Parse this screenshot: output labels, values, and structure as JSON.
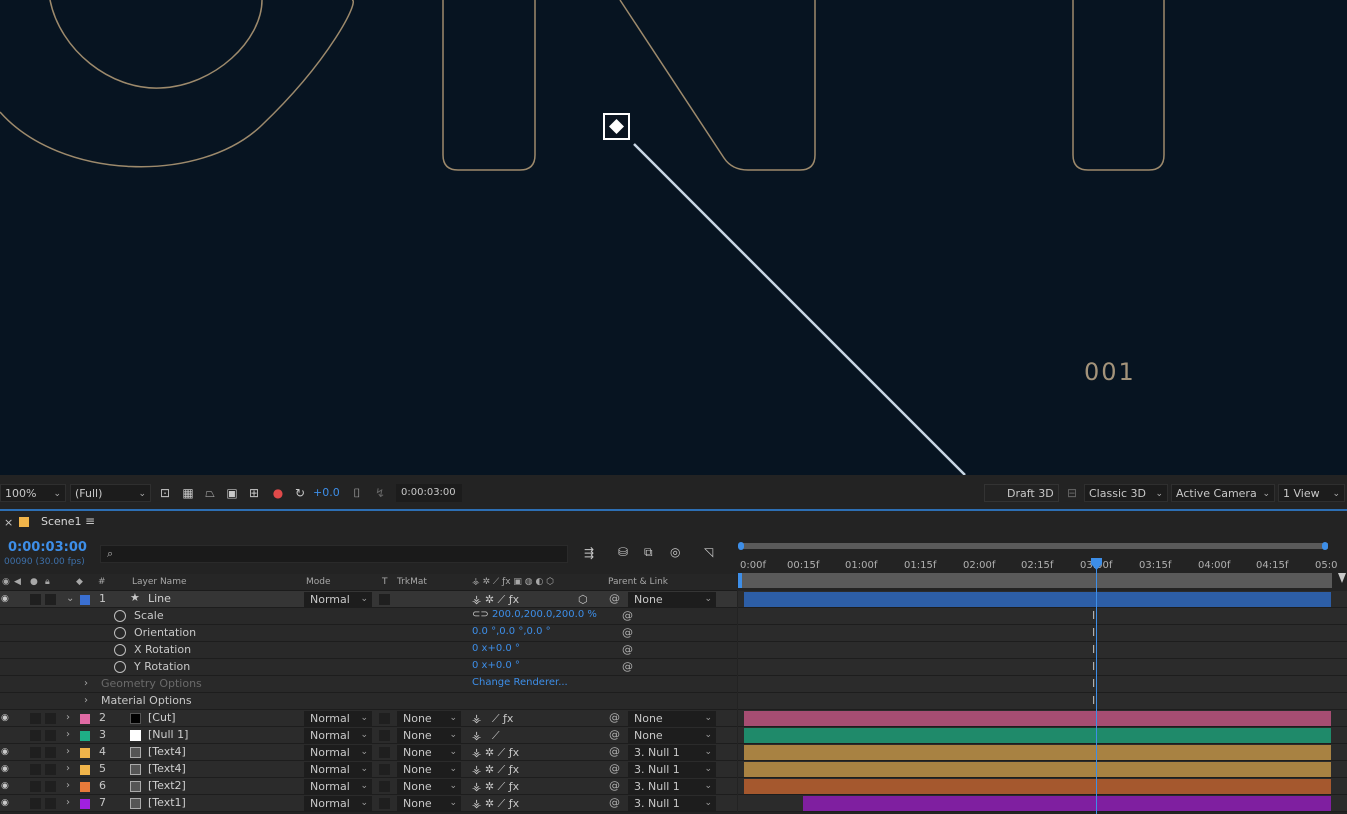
{
  "viewer": {
    "frame_number": "001",
    "zoom": "100%",
    "resolution": "(Full)",
    "exposure": "+0.0",
    "current_time": "0:00:03:00",
    "renderer": "Draft 3D",
    "renderer_mode": "Classic 3D",
    "camera": "Active Camera",
    "views": "1 View"
  },
  "panel": {
    "close": "×",
    "title": "Scene1",
    "menu": "≡"
  },
  "timeline": {
    "timecode": "0:00:03:00",
    "frames": "00090 (30.00 fps)",
    "search_placeholder": "",
    "ruler": [
      "0:00f",
      "00:15f",
      "01:00f",
      "01:15f",
      "02:00f",
      "02:15f",
      "03:00f",
      "03:15f",
      "04:00f",
      "04:15f",
      "05:0"
    ]
  },
  "columns": {
    "hash": "#",
    "layer_name": "Layer Name",
    "mode": "Mode",
    "t": "T",
    "trkmat": "TrkMat",
    "parent": "Parent & Link"
  },
  "layers": [
    {
      "num": "1",
      "name": "Line",
      "mode": "Normal",
      "trkmat": "",
      "parent": "None",
      "color": "#3a6fd1"
    },
    {
      "num": "2",
      "name": "[Cut]",
      "mode": "Normal",
      "trkmat": "None",
      "parent": "None",
      "color": "#e06aa4"
    },
    {
      "num": "3",
      "name": "[Null 1]",
      "mode": "Normal",
      "trkmat": "None",
      "parent": "None",
      "color": "#1fae86"
    },
    {
      "num": "4",
      "name": "[Text4]",
      "mode": "Normal",
      "trkmat": "None",
      "parent": "3. Null 1",
      "color": "#f0b44a"
    },
    {
      "num": "5",
      "name": "[Text4]",
      "mode": "Normal",
      "trkmat": "None",
      "parent": "3. Null 1",
      "color": "#f0b44a"
    },
    {
      "num": "6",
      "name": "[Text2]",
      "mode": "Normal",
      "trkmat": "None",
      "parent": "3. Null 1",
      "color": "#e87a3a"
    },
    {
      "num": "7",
      "name": "[Text1]",
      "mode": "Normal",
      "trkmat": "None",
      "parent": "3. Null 1",
      "color": "#a020e0"
    }
  ],
  "properties": {
    "scale_label": "Scale",
    "scale_value": "200.0,200.0,200.0 %",
    "orientation_label": "Orientation",
    "orientation_value": "0.0 °,0.0 °,0.0 °",
    "xrot_label": "X Rotation",
    "xrot_value": "0 x+0.0 °",
    "yrot_label": "Y Rotation",
    "yrot_value": "0 x+0.0 °",
    "geometry_label": "Geometry Options",
    "change_renderer": "Change Renderer...",
    "material_label": "Material Options"
  },
  "bar_colors": {
    "line": "#2d5ea6",
    "cut": "#a64d72",
    "null": "#1f8a6a",
    "text4a": "#a88242",
    "text4b": "#a88242",
    "text2": "#a5582e",
    "text1": "#7f1fa0"
  },
  "icons": [
    "eye-icon",
    "audio-icon",
    "solo-icon",
    "lock-icon",
    "label-icon",
    "search-icon",
    "stopwatch-icon",
    "pickwhip-icon",
    "camera-icon",
    "link-icon",
    "star-icon"
  ]
}
